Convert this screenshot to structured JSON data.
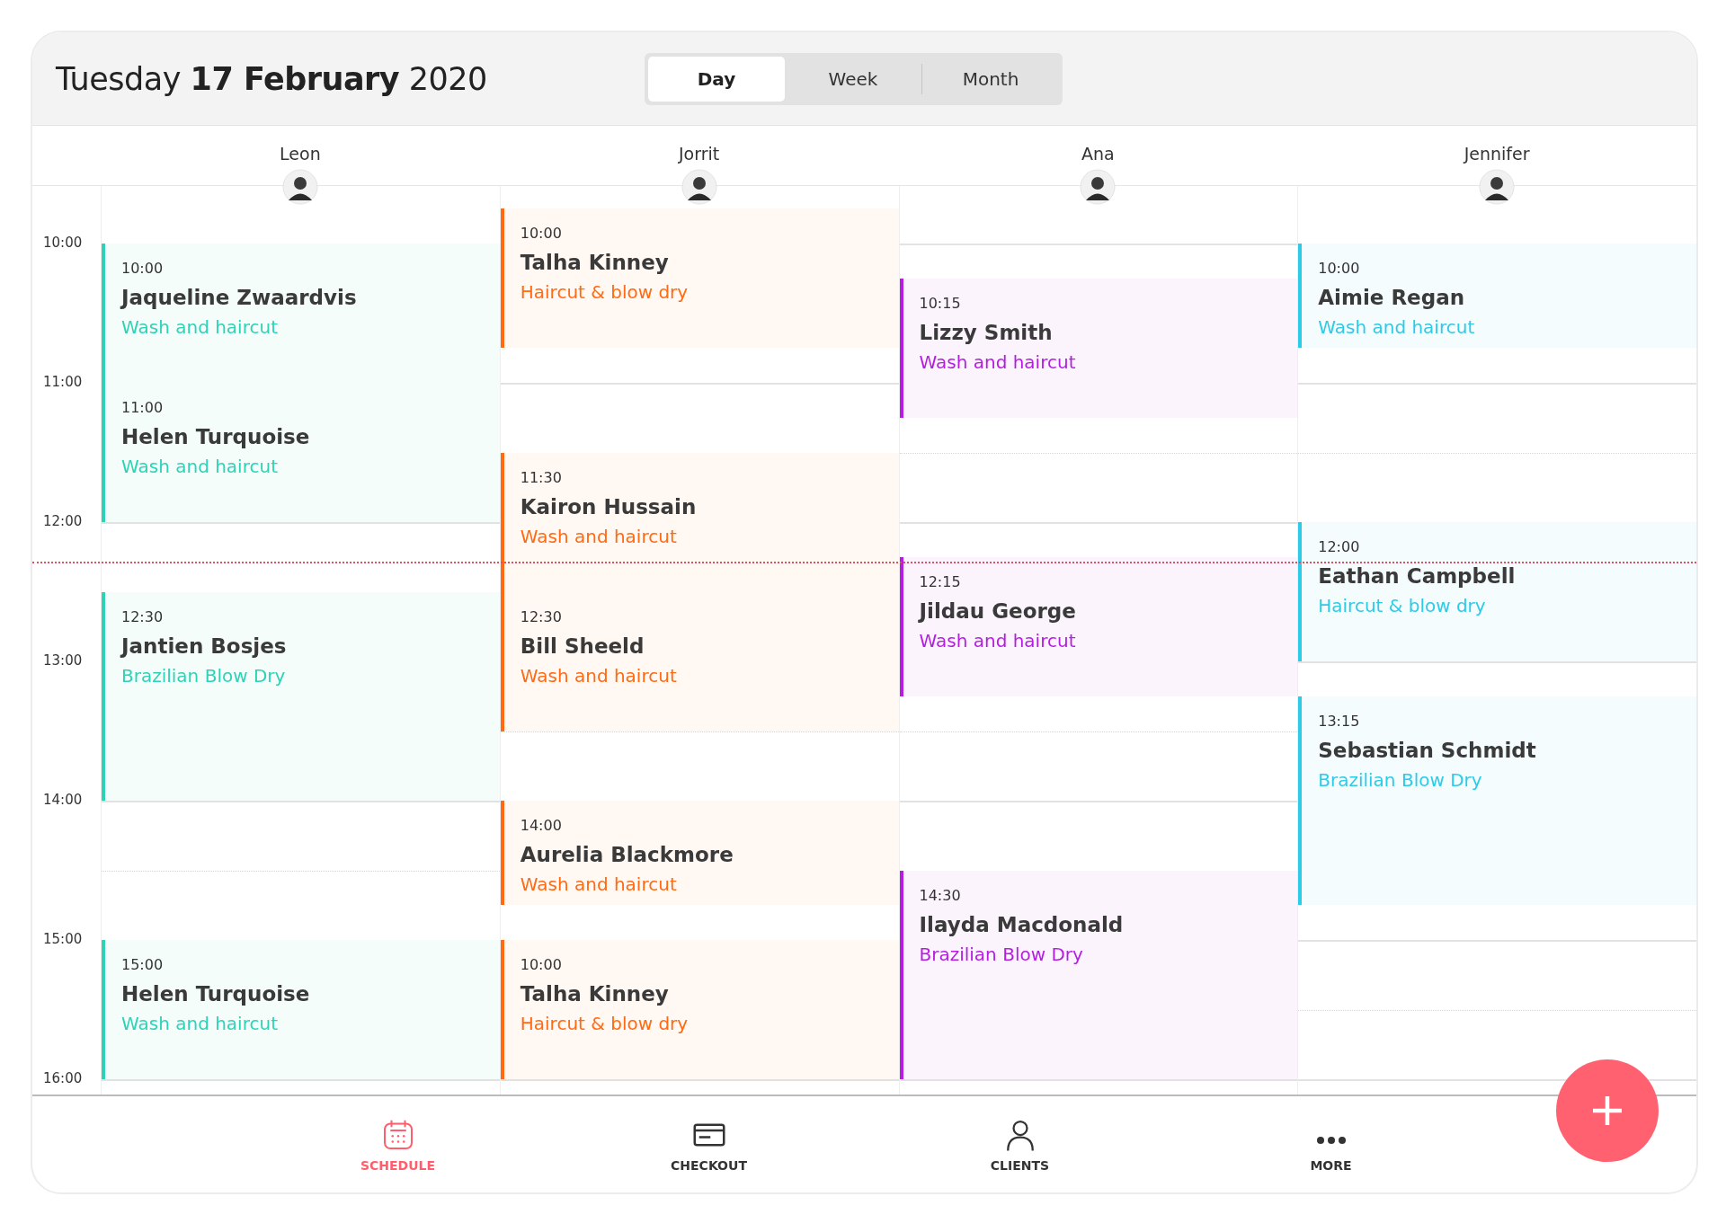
{
  "header": {
    "date_prefix": "Tuesday",
    "date_bold": "17 February",
    "date_suffix": "2020"
  },
  "view_tabs": [
    {
      "label": "Day",
      "selected": true
    },
    {
      "label": "Week",
      "selected": false
    },
    {
      "label": "Month",
      "selected": false
    }
  ],
  "hours": [
    {
      "kind": "hour",
      "label": "10:00"
    },
    {
      "kind": "hour",
      "label": "11:00"
    },
    {
      "kind": "hour",
      "label": "12:00"
    },
    {
      "kind": "now_line"
    },
    {
      "kind": "hour",
      "label": "13:00"
    },
    {
      "kind": "hour",
      "label": "14:00"
    },
    {
      "kind": "hour",
      "label": "15:00"
    },
    {
      "kind": "hour",
      "label": "16:00"
    }
  ],
  "staff": [
    {
      "name": "Leon",
      "color": "#2ed3b7",
      "slots": [
        {
          "kind": "gap15"
        },
        {
          "kind": "hour",
          "time": "10:00",
          "client": "Jaqueline Zwaardvis",
          "service": "Wash and haircut"
        },
        {
          "kind": "hour",
          "time": "11:00",
          "client": "Helen Turquoise",
          "service": "Wash and haircut"
        },
        {
          "kind": "gap30"
        },
        {
          "kind": "long",
          "time": "12:30",
          "client": "Jantien Bosjes",
          "service": "Brazilian Blow Dry"
        },
        {
          "kind": "gap60"
        },
        {
          "kind": "hour",
          "time": "15:00",
          "client": "Helen Turquoise",
          "service": "Wash and haircut"
        }
      ]
    },
    {
      "name": "Jorrit",
      "color": "#ff6a13",
      "slots": [
        {
          "kind": "hour",
          "time": "10:00",
          "client": "Talha Kinney",
          "service": "Haircut & blow dry"
        },
        {
          "kind": "gap45"
        },
        {
          "kind": "hour",
          "time": "11:30",
          "client": "Kairon Hussain",
          "service": "Wash and haircut"
        },
        {
          "kind": "hour",
          "time": "12:30",
          "client": "Bill Sheeld",
          "service": "Wash and haircut"
        },
        {
          "kind": "gap30"
        },
        {
          "kind": "short",
          "time": "14:00",
          "client": "Aurelia Blackmore",
          "service": "Wash and haircut"
        },
        {
          "kind": "gap15"
        },
        {
          "kind": "hour",
          "time": "10:00",
          "client": "Talha Kinney",
          "service": "Haircut & blow dry"
        }
      ]
    },
    {
      "name": "Ana",
      "color": "#b51ee0",
      "slots": [
        {
          "kind": "gap30"
        },
        {
          "kind": "hour",
          "time": "10:15",
          "client": "Lizzy Smith",
          "service": "Wash and haircut"
        },
        {
          "kind": "gap60"
        },
        {
          "kind": "hour",
          "time": "12:15",
          "client": "Jildau George",
          "service": "Wash and haircut"
        },
        {
          "kind": "gap75"
        },
        {
          "kind": "long",
          "time": "14:30",
          "client": "Ilayda Macdonald",
          "service": "Brazilian Blow Dry"
        }
      ]
    },
    {
      "name": "Jennifer",
      "color": "#2ccbe8",
      "slots": [
        {
          "kind": "gap15"
        },
        {
          "kind": "short",
          "time": "10:00",
          "client": "Aimie Regan",
          "service": "Wash and haircut"
        },
        {
          "kind": "gap75"
        },
        {
          "kind": "hour",
          "time": "12:00",
          "client": "Eathan Campbell",
          "service": "Haircut & blow dry"
        },
        {
          "kind": "gap15"
        },
        {
          "kind": "long",
          "time": "13:15",
          "client": "Sebastian Schmidt",
          "service": "Brazilian Blow Dry"
        }
      ]
    }
  ],
  "bottom_nav": [
    {
      "kind": "schedule",
      "label": "SCHEDULE",
      "selected": true
    },
    {
      "kind": "checkout",
      "label": "CHECKOUT",
      "selected": false
    },
    {
      "kind": "clients",
      "label": "CLIENTS",
      "selected": false
    },
    {
      "kind": "more",
      "label": "MORE",
      "selected": false
    }
  ]
}
